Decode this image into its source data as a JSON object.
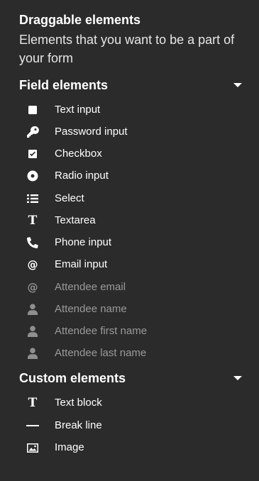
{
  "header": {
    "title": "Draggable elements",
    "subtitle": "Elements that you want to be a part of your form"
  },
  "sections": [
    {
      "title": "Field elements",
      "items": [
        {
          "label": "Text input",
          "icon": "square-icon",
          "disabled": false
        },
        {
          "label": "Password input",
          "icon": "key-icon",
          "disabled": false
        },
        {
          "label": "Checkbox",
          "icon": "checkbox-icon",
          "disabled": false
        },
        {
          "label": "Radio input",
          "icon": "radio-icon",
          "disabled": false
        },
        {
          "label": "Select",
          "icon": "list-icon",
          "disabled": false
        },
        {
          "label": "Textarea",
          "icon": "text-icon",
          "disabled": false
        },
        {
          "label": "Phone input",
          "icon": "phone-icon",
          "disabled": false
        },
        {
          "label": "Email input",
          "icon": "at-icon",
          "disabled": false
        },
        {
          "label": "Attendee email",
          "icon": "at-icon",
          "disabled": true
        },
        {
          "label": "Attendee name",
          "icon": "user-icon",
          "disabled": true
        },
        {
          "label": "Attendee first name",
          "icon": "user-icon",
          "disabled": true
        },
        {
          "label": "Attendee last name",
          "icon": "user-icon",
          "disabled": true
        }
      ]
    },
    {
      "title": "Custom elements",
      "items": [
        {
          "label": "Text block",
          "icon": "text-icon",
          "disabled": false
        },
        {
          "label": "Break line",
          "icon": "minus-icon",
          "disabled": false
        },
        {
          "label": "Image",
          "icon": "image-icon",
          "disabled": false
        }
      ]
    }
  ],
  "colors": {
    "background": "#2b2b2b",
    "text": "#ffffff",
    "disabled_text": "#9a9a9a"
  }
}
